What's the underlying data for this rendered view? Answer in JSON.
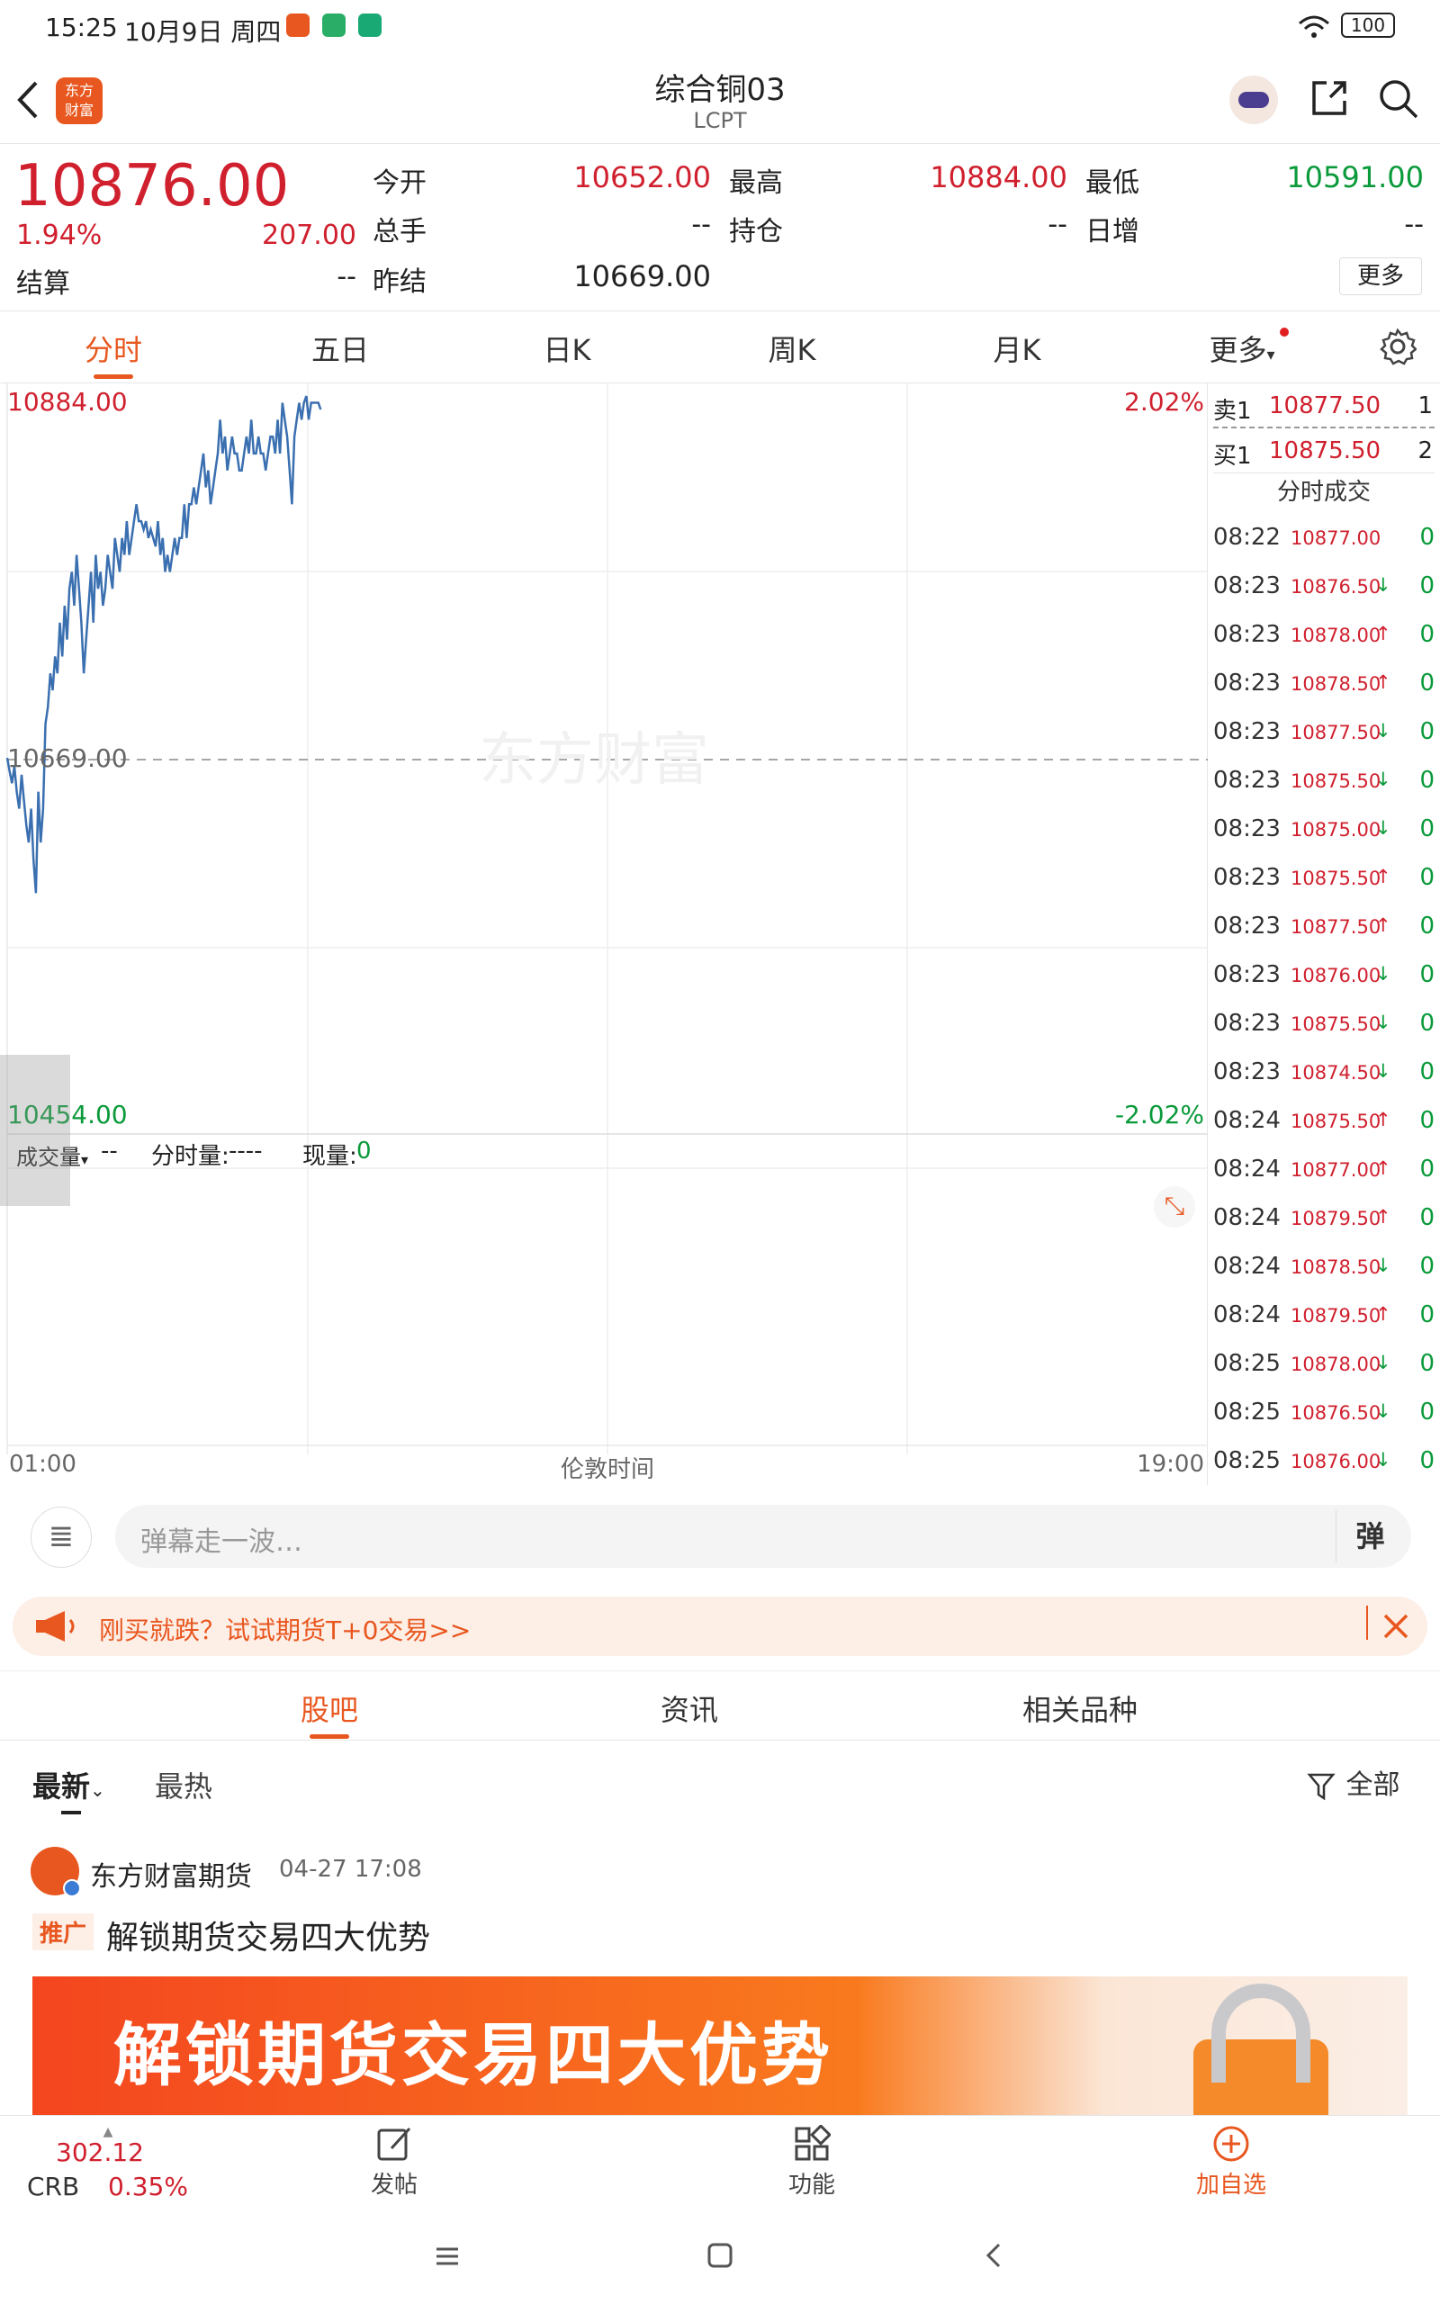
{
  "status_bar": {
    "time": "15:25",
    "date": "10月9日 周四",
    "battery": "100"
  },
  "header": {
    "title": "综合铜03",
    "subtitle": "LCPT",
    "logo_text": "东方财富"
  },
  "quote": {
    "price": "10876.00",
    "change_pct": "1.94%",
    "change": "207.00",
    "open_label": "今开",
    "open": "10652.00",
    "high_label": "最高",
    "high": "10884.00",
    "low_label": "最低",
    "low": "10591.00",
    "volume_label": "总手",
    "volume": "--",
    "oi_label": "持仓",
    "oi": "--",
    "daily_inc_label": "日增",
    "daily_inc": "--",
    "settle_label": "结算",
    "settle": "--",
    "prev_label": "昨结",
    "prev": "10669.00",
    "more_button": "更多"
  },
  "tabs": [
    "分时",
    "五日",
    "日K",
    "周K",
    "月K",
    "更多"
  ],
  "chart_data": {
    "type": "line",
    "x_start_label": "01:00",
    "x_mid_label": "伦敦时间",
    "x_end_label": "19:00",
    "y_top": "10884.00",
    "y_mid": "10669.00",
    "y_bottom": "10454.00",
    "pct_top": "2.02%",
    "pct_bottom": "-2.02%",
    "ylim": [
      10454,
      10884
    ],
    "reference": 10669,
    "x_range": [
      0,
      1080
    ],
    "watermark": "东方财富",
    "values": [
      10670,
      10662,
      10655,
      10665,
      10650,
      10640,
      10660,
      10645,
      10630,
      10620,
      10640,
      10610,
      10590,
      10650,
      10620,
      10640,
      10690,
      10700,
      10720,
      10710,
      10730,
      10720,
      10750,
      10730,
      10760,
      10740,
      10770,
      10780,
      10760,
      10790,
      10770,
      10750,
      10720,
      10740,
      10760,
      10780,
      10750,
      10790,
      10770,
      10780,
      10760,
      10770,
      10790,
      10780,
      10770,
      10800,
      10790,
      10780,
      10800,
      10790,
      10810,
      10790,
      10800,
      10810,
      10820,
      10810,
      10810,
      10805,
      10810,
      10800,
      10805,
      10800,
      10795,
      10810,
      10790,
      10800,
      10780,
      10790,
      10780,
      10790,
      10800,
      10790,
      10800,
      10800,
      10820,
      10800,
      10820,
      10820,
      10830,
      10820,
      10830,
      10840,
      10850,
      10830,
      10840,
      10820,
      10830,
      10840,
      10850,
      10870,
      10850,
      10860,
      10840,
      10850,
      10860,
      10850,
      10850,
      10840,
      10840,
      10850,
      10860,
      10850,
      10870,
      10850,
      10850,
      10860,
      10850,
      10850,
      10840,
      10850,
      10860,
      10860,
      10850,
      10870,
      10850,
      10880,
      10870,
      10860,
      10840,
      10820,
      10860,
      10870,
      10880,
      10870,
      10880,
      10884,
      10870,
      10880,
      10880,
      10880,
      10880,
      10876
    ]
  },
  "volume_panel": {
    "label": "成交量",
    "vol_value": "--",
    "fenshi_label": "分时量:",
    "fenshi_value": "----",
    "now_label": "现量:",
    "now_value": "0"
  },
  "orderbook": {
    "sell_label": "卖1",
    "sell_price": "10877.50",
    "sell_qty": "1",
    "buy_label": "买1",
    "buy_price": "10875.50",
    "buy_qty": "2",
    "trades_title": "分时成交",
    "trades": [
      {
        "time": "08:22",
        "price": "10877.00",
        "dir": "",
        "qty": "0"
      },
      {
        "time": "08:23",
        "price": "10876.50",
        "dir": "down",
        "qty": "0"
      },
      {
        "time": "08:23",
        "price": "10878.00",
        "dir": "up",
        "qty": "0"
      },
      {
        "time": "08:23",
        "price": "10878.50",
        "dir": "up",
        "qty": "0"
      },
      {
        "time": "08:23",
        "price": "10877.50",
        "dir": "down",
        "qty": "0"
      },
      {
        "time": "08:23",
        "price": "10875.50",
        "dir": "down",
        "qty": "0"
      },
      {
        "time": "08:23",
        "price": "10875.00",
        "dir": "down",
        "qty": "0"
      },
      {
        "time": "08:23",
        "price": "10875.50",
        "dir": "up",
        "qty": "0"
      },
      {
        "time": "08:23",
        "price": "10877.50",
        "dir": "up",
        "qty": "0"
      },
      {
        "time": "08:23",
        "price": "10876.00",
        "dir": "down",
        "qty": "0"
      },
      {
        "time": "08:23",
        "price": "10875.50",
        "dir": "down",
        "qty": "0"
      },
      {
        "time": "08:23",
        "price": "10874.50",
        "dir": "down",
        "qty": "0"
      },
      {
        "time": "08:24",
        "price": "10875.50",
        "dir": "up",
        "qty": "0"
      },
      {
        "time": "08:24",
        "price": "10877.00",
        "dir": "up",
        "qty": "0"
      },
      {
        "time": "08:24",
        "price": "10879.50",
        "dir": "up",
        "qty": "0"
      },
      {
        "time": "08:24",
        "price": "10878.50",
        "dir": "down",
        "qty": "0"
      },
      {
        "time": "08:24",
        "price": "10879.50",
        "dir": "up",
        "qty": "0"
      },
      {
        "time": "08:25",
        "price": "10878.00",
        "dir": "down",
        "qty": "0"
      },
      {
        "time": "08:25",
        "price": "10876.50",
        "dir": "down",
        "qty": "0"
      },
      {
        "time": "08:25",
        "price": "10876.00",
        "dir": "down",
        "qty": "0"
      }
    ]
  },
  "danmaku": {
    "placeholder": "弹幕走一波…",
    "send": "弹"
  },
  "promo_banner": {
    "text": "刚买就跌？试试期货T+0交易>>"
  },
  "content_tabs": [
    "股吧",
    "资讯",
    "相关品种"
  ],
  "sub_tabs": {
    "latest": "最新",
    "hot": "最热",
    "filter": "全部"
  },
  "post": {
    "author": "东方财富期货",
    "time": "04-27 17:08",
    "tag": "推广",
    "title": "解锁期货交易四大优势",
    "banner_text": "解锁期货交易四大优势"
  },
  "bottom_nav": {
    "crb_value": "302.12",
    "crb_label": "CRB",
    "crb_change": "0.35%",
    "post": "发帖",
    "functions": "功能",
    "add_watch": "加自选"
  },
  "colors": {
    "accent": "#e8571f",
    "up": "#d0202e",
    "down": "#0a9a3a",
    "line": "#3a6fb0"
  }
}
